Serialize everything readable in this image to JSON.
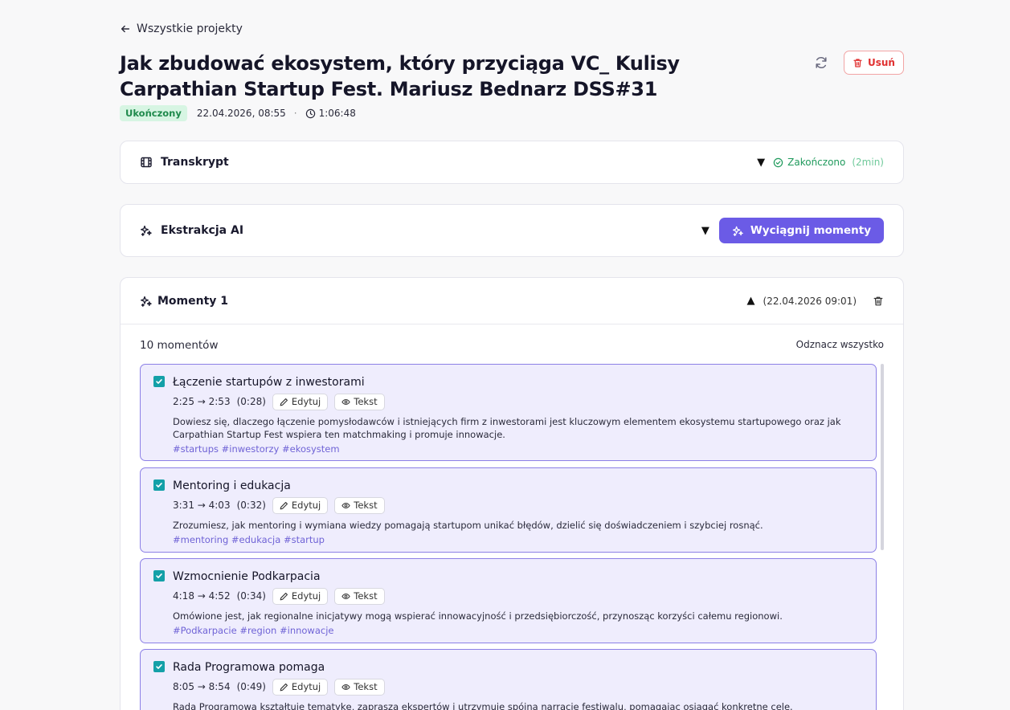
{
  "nav": {
    "back_label": "Wszystkie projekty"
  },
  "project": {
    "title": "Jak zbudować ekosystem, który przyciąga VC_ Kulisy Carpathian Startup Fest. Mariusz Bednarz DSS#31",
    "status": "Ukończony",
    "date": "22.04.2026, 08:55",
    "separator": "·",
    "duration": "1:06:48",
    "delete_label": "Usuń"
  },
  "transcript": {
    "title": "Transkrypt",
    "caret": "▼",
    "status_label": "Zakończono",
    "status_time": "(2min)"
  },
  "extraction": {
    "title": "Ekstrakcja AI",
    "caret": "▼",
    "button_label": "Wyciągnij momenty"
  },
  "moments_panel": {
    "title": "Momenty 1",
    "caret": "▲",
    "timestamp": "(22.04.2026 09:01)",
    "count_label": "10 momentów",
    "unselect_all": "Odznacz wszystko",
    "edit_label": "Edytuj",
    "text_label": "Tekst",
    "items": [
      {
        "title": "Łączenie startupów z inwestorami",
        "range": "2:25 → 2:53",
        "length": "(0:28)",
        "description": "Dowiesz się, dlaczego łączenie pomysłodawców i istniejących firm z inwestorami jest kluczowym elementem ekosystemu startupowego oraz jak Carpathian Startup Fest wspiera ten matchmaking i promuje innowacje.",
        "tags": "#startups #inwestorzy #ekosystem"
      },
      {
        "title": "Mentoring i edukacja",
        "range": "3:31 → 4:03",
        "length": "(0:32)",
        "description": "Zrozumiesz, jak mentoring i wymiana wiedzy pomagają startupom unikać błędów, dzielić się doświadczeniem i szybciej rosnąć.",
        "tags": "#mentoring #edukacja #startup"
      },
      {
        "title": "Wzmocnienie Podkarpacia",
        "range": "4:18 → 4:52",
        "length": "(0:34)",
        "description": "Omówione jest, jak regionalne inicjatywy mogą wspierać innowacyjność i przedsiębiorczość, przynosząc korzyści całemu regionowi.",
        "tags": "#Podkarpacie #region #innowacje"
      },
      {
        "title": "Rada Programowa pomaga",
        "range": "8:05 → 8:54",
        "length": "(0:49)",
        "description": "Rada Programowa kształtuje tematykę, zaprasza ekspertów i utrzymuje spójną narrację festiwalu, pomagając osiągać konkretne cele.",
        "tags": ""
      }
    ]
  },
  "colors": {
    "accent": "#6b5be6",
    "success": "#1f9a5c",
    "danger": "#e03030",
    "moment_bg": "#efedfd",
    "checkbox": "#14a0a8"
  }
}
